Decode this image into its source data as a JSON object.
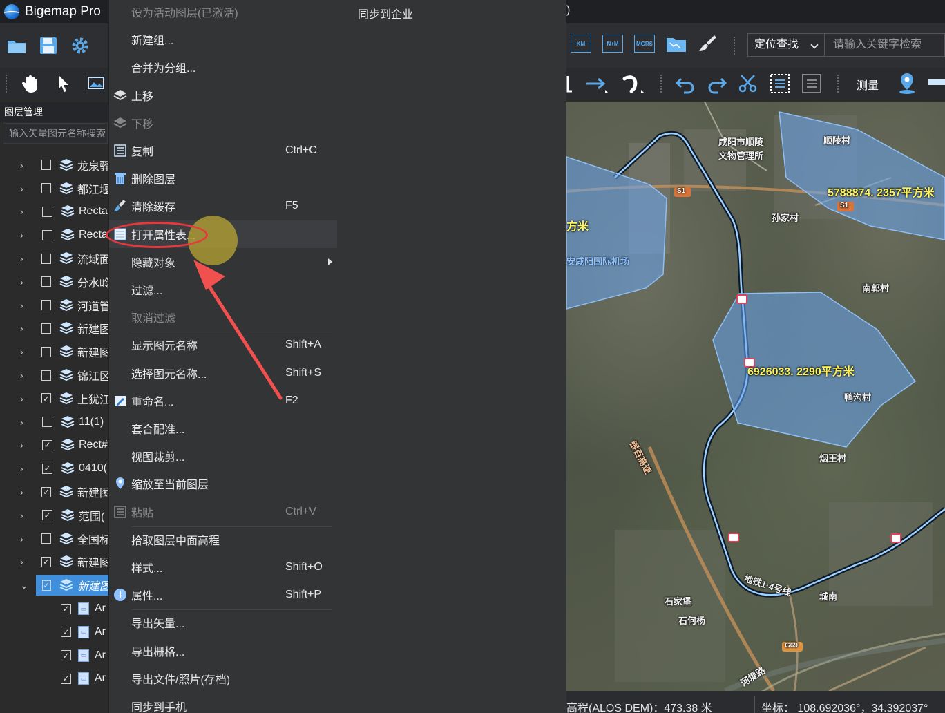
{
  "app": {
    "title": "Bigemap Pro",
    "title_right_fragment": ")"
  },
  "layer_panel": {
    "header": "图层管理",
    "search_placeholder": "输入矢量图元名称搜索",
    "layers": [
      {
        "name": "龙泉驿",
        "checked": false
      },
      {
        "name": "都江堰",
        "checked": false
      },
      {
        "name": "Recta",
        "checked": false
      },
      {
        "name": "Recta",
        "checked": false
      },
      {
        "name": "流域面",
        "checked": false
      },
      {
        "name": "分水岭",
        "checked": false
      },
      {
        "name": "河道管",
        "checked": false
      },
      {
        "name": "新建图",
        "checked": false
      },
      {
        "name": "新建图",
        "checked": false
      },
      {
        "name": "锦江区",
        "checked": false
      },
      {
        "name": "上犹江",
        "checked": true
      },
      {
        "name": "11(1)",
        "checked": false
      },
      {
        "name": "Rect#",
        "checked": true
      },
      {
        "name": "0410(",
        "checked": true
      },
      {
        "name": "新建图",
        "checked": true
      },
      {
        "name": "范围(",
        "checked": true
      },
      {
        "name": "全国标",
        "checked": false
      },
      {
        "name": "新建图",
        "checked": true
      },
      {
        "name": "新建图",
        "checked": true,
        "selected": true
      }
    ],
    "children": [
      {
        "name": "Ar",
        "checked": true
      },
      {
        "name": "Ar",
        "checked": true
      },
      {
        "name": "Ar",
        "checked": true
      },
      {
        "name": "Ar",
        "checked": true
      }
    ]
  },
  "context_menu": {
    "sync_enterprise": "同步到企业",
    "items": [
      {
        "label": "设为活动图层(已激活)",
        "shortcut": "",
        "disabled": true
      },
      {
        "label": "新建组...",
        "shortcut": ""
      },
      {
        "label": "合并为分组...",
        "shortcut": ""
      },
      {
        "label": "上移",
        "shortcut": "",
        "icon": "move-up-icon"
      },
      {
        "label": "下移",
        "shortcut": "",
        "icon": "move-down-icon",
        "disabled": true
      },
      {
        "label": "复制",
        "shortcut": "Ctrl+C",
        "icon": "copy-icon"
      },
      {
        "label": "删除图层",
        "shortcut": "",
        "icon": "trash-icon"
      },
      {
        "label": "清除缓存",
        "shortcut": "F5",
        "icon": "broom-icon"
      },
      {
        "label": "打开属性表...",
        "shortcut": "",
        "icon": "table-icon",
        "hover": true
      },
      {
        "label": "隐藏对象",
        "shortcut": "",
        "submenu": true
      },
      {
        "label": "过滤...",
        "shortcut": ""
      },
      {
        "label": "取消过滤",
        "shortcut": "",
        "disabled": true
      },
      {
        "label": "显示图元名称",
        "shortcut": "Shift+A"
      },
      {
        "label": "选择图元名称...",
        "shortcut": "Shift+S"
      },
      {
        "label": "重命名...",
        "shortcut": "F2",
        "icon": "rename-icon"
      },
      {
        "label": "套合配准...",
        "shortcut": ""
      },
      {
        "label": "视图裁剪...",
        "shortcut": ""
      },
      {
        "label": "缩放至当前图层",
        "shortcut": "",
        "icon": "location-pin-icon"
      },
      {
        "label": "粘贴",
        "shortcut": "Ctrl+V",
        "icon": "paste-icon",
        "disabled": true
      },
      {
        "label": "拾取图层中面高程",
        "shortcut": ""
      },
      {
        "label": "样式...",
        "shortcut": "Shift+O"
      },
      {
        "label": "属性...",
        "shortcut": "Shift+P",
        "icon": "info-icon"
      },
      {
        "label": "导出矢量...",
        "shortcut": ""
      },
      {
        "label": "导出栅格...",
        "shortcut": ""
      },
      {
        "label": "导出文件/照片(存档)",
        "shortcut": ""
      },
      {
        "label": "同步到手机",
        "shortcut": ""
      }
    ]
  },
  "toolbar_right": {
    "tile_km": "KM",
    "tile_nm": "N+M",
    "tile_mgrs": "MGRS",
    "locate_label": "定位查找",
    "search_placeholder": "请输入关键字检索",
    "measure_label": "测量"
  },
  "map": {
    "place_labels": [
      "咸阳市顺陵",
      "文物管理所",
      "顺陵村",
      "孙家村",
      "安咸阳国际机场",
      "南郭村",
      "鸭沟村",
      "烟王村",
      "石家堡",
      "石何杨",
      "城南",
      "河堤路",
      "银百高速",
      "地铁1·4号线"
    ],
    "road_shields": [
      "S1",
      "S1",
      "G69"
    ],
    "area_labels": [
      "5788874. 2357平方米",
      "6926033. 2290平方米",
      "方米"
    ]
  },
  "status": {
    "elevation": "高程(ALOS DEM)：473.38 米",
    "coordinate": "坐标：  108.692036°，34.392037°"
  },
  "colors": {
    "accent": "#3f8fdd",
    "polygon_fill": "#6aa6f0",
    "annotation_red": "#e8383d",
    "area_label": "#fff45a"
  }
}
